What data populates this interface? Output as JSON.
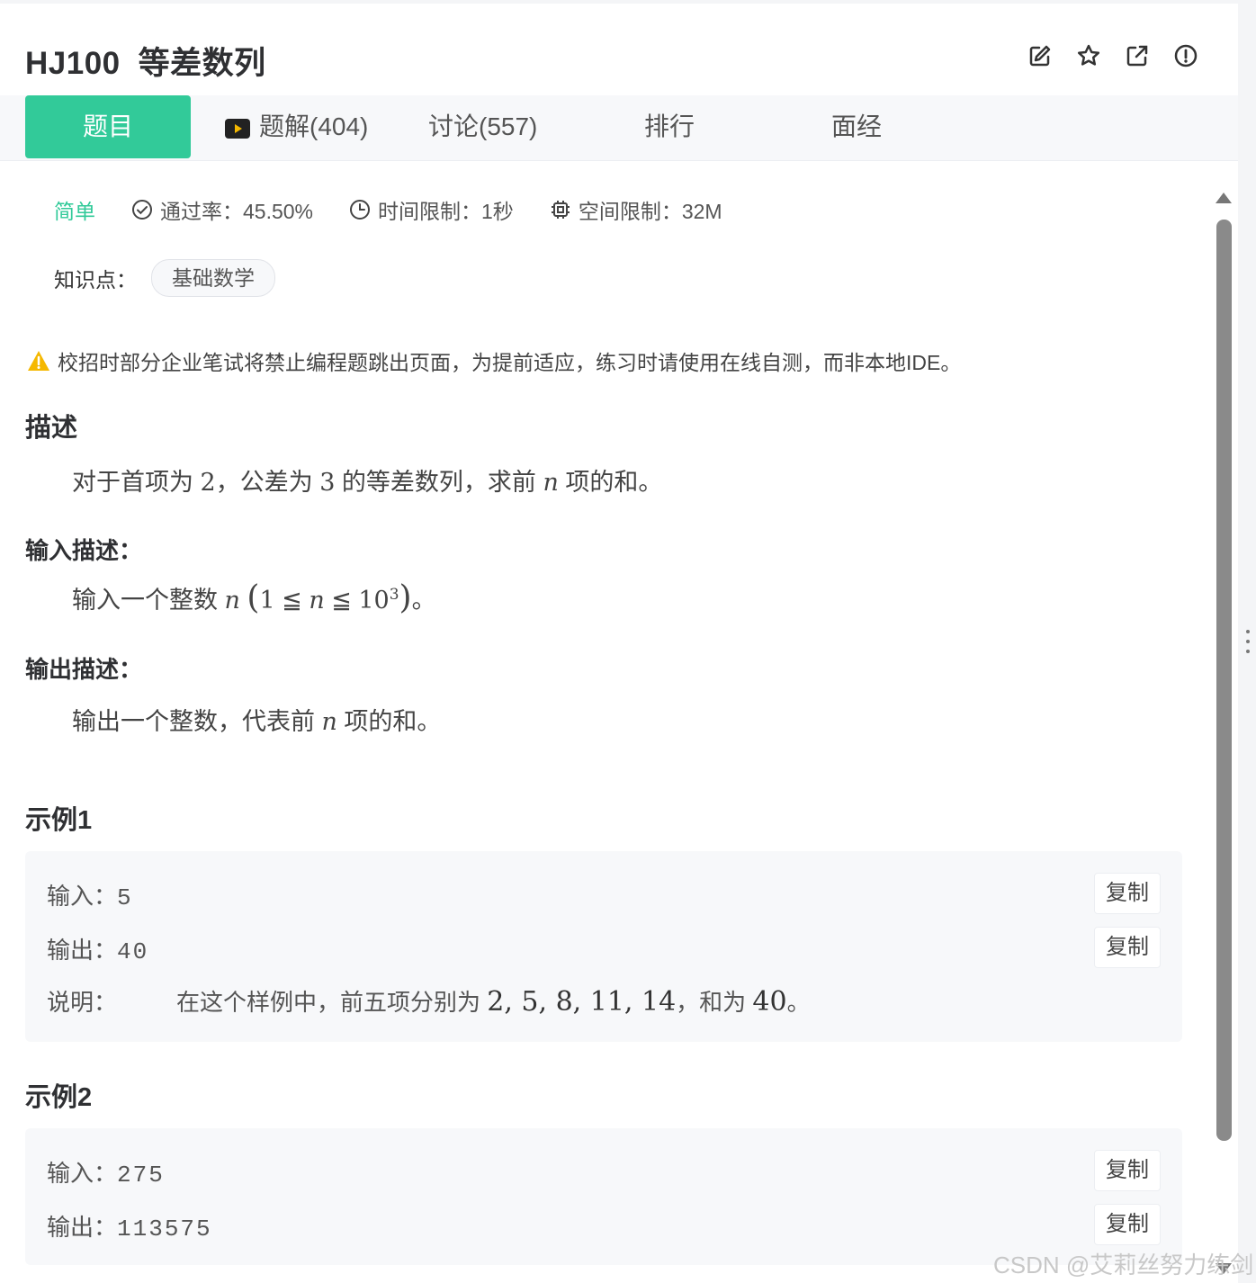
{
  "header": {
    "code": "HJ100",
    "title": "等差数列",
    "icons": [
      "edit-icon",
      "star-icon",
      "share-icon",
      "report-icon"
    ]
  },
  "tabs": [
    {
      "label": "题目",
      "active": true
    },
    {
      "label": "题解(404)",
      "icon": "video-icon"
    },
    {
      "label": "讨论(557)"
    },
    {
      "label": "排行"
    },
    {
      "label": "面经"
    }
  ],
  "meta": {
    "difficulty": "简单",
    "pass_rate": "通过率：45.50%",
    "time_limit": "时间限制：1秒",
    "space_limit": "空间限制：32M"
  },
  "knowledge": {
    "label": "知识点：",
    "tag": "基础数学"
  },
  "warning": "校招时部分企业笔试将禁止编程题跳出页面，为提前适应，练习时请使用在线自测，而非本地IDE。",
  "description": {
    "heading": "描述",
    "text_a": "对于首项为",
    "num_a": "2",
    "text_b": "，公差为",
    "num_b": "3",
    "text_c": "的等差数列，求前",
    "var": "n",
    "text_d": "项的和。"
  },
  "input_desc": {
    "heading": "输入描述：",
    "text_a": "输入一个整数",
    "var": "n",
    "range_open": "(",
    "range_low": "1",
    "leq": "≦",
    "range_var": "n",
    "range_high_base": "10",
    "range_high_exp": "3",
    "range_close": ")",
    "text_end": "。"
  },
  "output_desc": {
    "heading": "输出描述：",
    "text_a": "输出一个整数，代表前",
    "var": "n",
    "text_b": "项的和。"
  },
  "examples": [
    {
      "heading": "示例1",
      "input_label": "输入：",
      "input": "5",
      "output_label": "输出：",
      "output": "40",
      "explain_label": "说明：",
      "explain_text": "在这个样例中，前五项分别为",
      "explain_seq": "2, 5, 8, 11, 14",
      "explain_mid": "，和为",
      "explain_sum": "40",
      "explain_end": "。",
      "copy_label": "复制"
    },
    {
      "heading": "示例2",
      "input_label": "输入：",
      "input": "275",
      "output_label": "输出：",
      "output": "113575",
      "copy_label": "复制"
    }
  ],
  "watermark": "CSDN @艾莉丝努力练剑",
  "colors": {
    "accent": "#32ca99",
    "warning": "#f5b800"
  }
}
